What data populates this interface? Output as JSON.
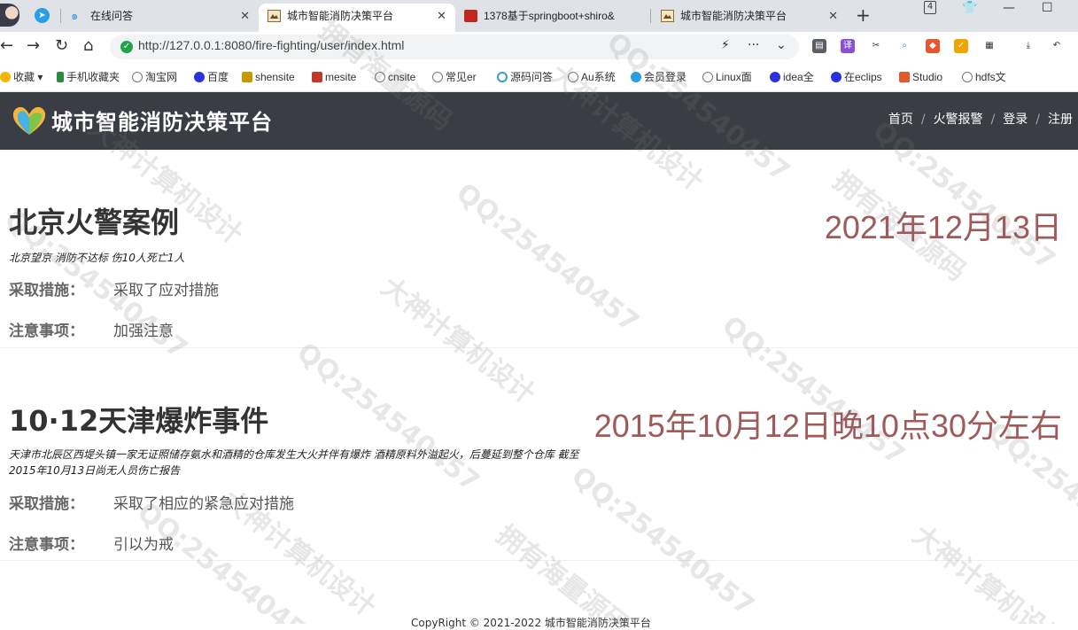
{
  "browser": {
    "tabs": [
      {
        "label": "在线问答",
        "active": false
      },
      {
        "label": "城市智能消防决策平台",
        "active": true
      },
      {
        "label": "1378基于springboot+shiro&",
        "active": false
      },
      {
        "label": "城市智能消防决策平台",
        "active": false
      }
    ],
    "tab_count": "4",
    "url": "http://127.0.0.1:8080/fire-fighting/user/index.html"
  },
  "bookmarks": [
    {
      "label": "收藏",
      "icon": "star-icon",
      "color": "#f5b400"
    },
    {
      "label": "手机收藏夹",
      "icon": "phone-icon",
      "color": "#2a8c3e"
    },
    {
      "label": "淘宝网",
      "icon": "globe-icon",
      "color": "#777777"
    },
    {
      "label": "百度",
      "icon": "baidu-icon",
      "color": "#2932e1"
    },
    {
      "label": "shensite",
      "icon": "grid-icon",
      "color": "#c79a00"
    },
    {
      "label": "mesite",
      "icon": "grid-icon",
      "color": "#c0392b"
    },
    {
      "label": "cnsite",
      "icon": "globe-icon",
      "color": "#777777"
    },
    {
      "label": "常见er",
      "icon": "globe-icon",
      "color": "#777777"
    },
    {
      "label": "源码问答",
      "icon": "swirl-icon",
      "color": "#3a9ad9"
    },
    {
      "label": "Au系统",
      "icon": "globe-icon",
      "color": "#777777"
    },
    {
      "label": "会员登录",
      "icon": "cloud-icon",
      "color": "#2a9ee3"
    },
    {
      "label": "Linux面",
      "icon": "globe-icon",
      "color": "#777777"
    },
    {
      "label": "idea全",
      "icon": "baidu-icon",
      "color": "#2932e1"
    },
    {
      "label": "在eclips",
      "icon": "baidu-icon",
      "color": "#2932e1"
    },
    {
      "label": "Studio",
      "icon": "c-icon",
      "color": "#e05a2b"
    },
    {
      "label": "hdfs文",
      "icon": "globe-icon",
      "color": "#777777"
    }
  ],
  "site": {
    "brand": "城市智能消防决策平台",
    "menu": [
      "首页",
      "火警报警",
      "登录",
      "注册"
    ],
    "colors": {
      "header_bg": "#3a3d44",
      "date": "#a05a5a"
    }
  },
  "cases": [
    {
      "title": "北京火警案例",
      "date": "2021年12月13日",
      "description": "北京望京 消防不达标 伤10人死亡1人",
      "measures_label": "采取措施：",
      "measures": "采取了应对措施",
      "notes_label": "注意事项：",
      "notes": "加强注意"
    },
    {
      "title": "10·12天津爆炸事件",
      "date": "2015年10月12日晚10点30分左右",
      "description": "天津市北辰区西堤头镇一家无证照储存氨水和酒精的仓库发生大火并伴有爆炸 酒精原料外溢起火，后蔓延到整个仓库 截至2015年10月13日尚无人员伤亡报告",
      "measures_label": "采取措施：",
      "measures": "采取了相应的紧急应对措施",
      "notes_label": "注意事项：",
      "notes": "引以为戒"
    }
  ],
  "footer": "CopyRight © 2021-2022 城市智能消防决策平台",
  "watermark": [
    "大神计算机设计",
    "QQ:25454045",
    "QQ:254540457",
    "拥有海量源码"
  ]
}
